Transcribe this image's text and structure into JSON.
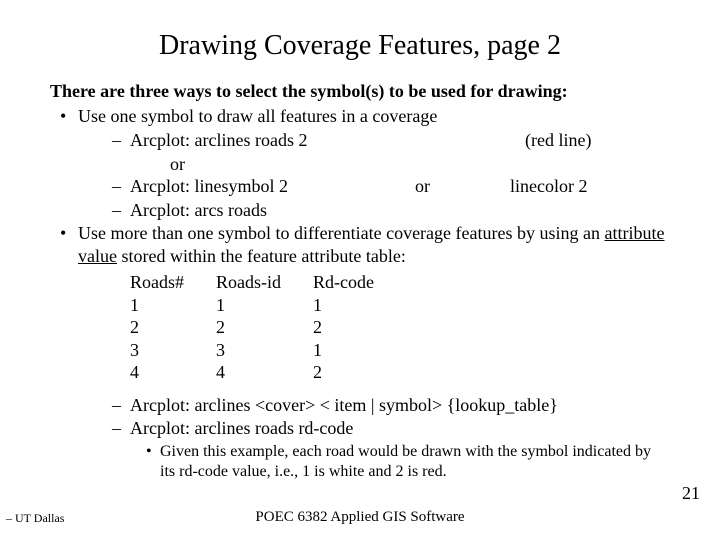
{
  "title": "Drawing Coverage Features, page 2",
  "intro": "There are three ways to select the symbol(s) to be used for drawing:",
  "b1": "Use one symbol to draw all features in a coverage",
  "s1a": "Arcplot:  arclines roads 2",
  "s1a_right": "(red line)",
  "s1a_or": "or",
  "s1b_left": "Arcplot:  linesymbol 2",
  "s1b_mid": "or",
  "s1b_right": "linecolor 2",
  "s1c": "Arcplot:  arcs roads",
  "b2_a": "Use more than one symbol to differentiate coverage features by using an ",
  "b2_u": "attribute value",
  "b2_b": " stored within the feature attribute table:",
  "table": {
    "headers": [
      "Roads#",
      "Roads-id",
      "Rd-code"
    ],
    "rows": [
      [
        "1",
        "1",
        "1"
      ],
      [
        "2",
        "2",
        "2"
      ],
      [
        "3",
        "3",
        "1"
      ],
      [
        "4",
        "4",
        "2"
      ]
    ]
  },
  "s2a": "Arcplot:  arclines <cover> < item | symbol> {lookup_table}",
  "s2b": "Arcplot:  arclines  roads  rd-code",
  "s3": "Given this example, each road would be drawn with the symbol indicated by its rd-code value, i.e., 1 is white and 2 is red.",
  "footer_left": "– UT Dallas",
  "footer_center": "POEC 6382 Applied GIS Software",
  "page_num": "21"
}
